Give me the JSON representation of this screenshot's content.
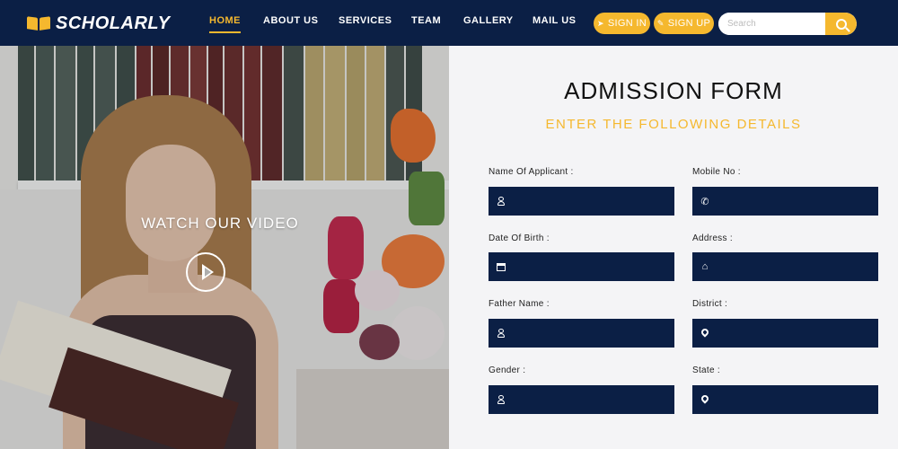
{
  "brand": {
    "name": "SCHOLARLY",
    "accent": "#f5b82e",
    "navy": "#0b1f45"
  },
  "nav": {
    "items": [
      {
        "label": "HOME",
        "active": true
      },
      {
        "label": "ABOUT US",
        "active": false
      },
      {
        "label": "SERVICES",
        "active": false
      },
      {
        "label": "TEAM",
        "active": false
      },
      {
        "label": "GALLERY",
        "active": false
      },
      {
        "label": "MAIL US",
        "active": false
      }
    ],
    "sign_in": {
      "label": "SIGN IN",
      "icon": "sign-in-icon"
    },
    "sign_up": {
      "label": "SIGN UP",
      "icon": "edit-icon"
    },
    "search": {
      "placeholder": "Search",
      "icon": "search-icon"
    }
  },
  "hero": {
    "video_label": "WATCH OUR VIDEO",
    "play_icon": "play-icon"
  },
  "form": {
    "title": "ADMISSION FORM",
    "subtitle": "ENTER THE FOLLOWING DETAILS",
    "fields": [
      {
        "label": "Name Of Applicant :",
        "icon": "user-icon",
        "value": ""
      },
      {
        "label": "Mobile No :",
        "icon": "phone-icon",
        "value": ""
      },
      {
        "label": "Date Of Birth :",
        "icon": "calendar-icon",
        "value": ""
      },
      {
        "label": "Address :",
        "icon": "home-icon",
        "value": ""
      },
      {
        "label": "Father Name :",
        "icon": "user-icon",
        "value": ""
      },
      {
        "label": "District :",
        "icon": "map-marker-icon",
        "value": ""
      },
      {
        "label": "Gender :",
        "icon": "user-icon",
        "value": ""
      },
      {
        "label": "State :",
        "icon": "map-marker-icon",
        "value": ""
      }
    ]
  }
}
